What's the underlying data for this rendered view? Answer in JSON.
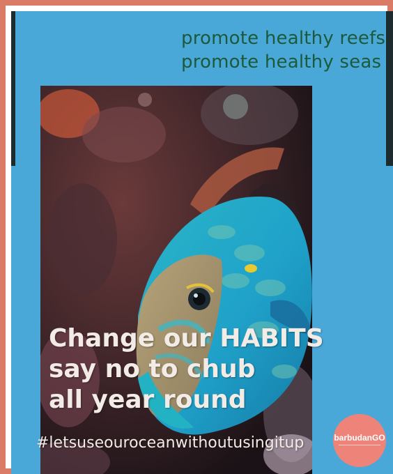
{
  "poster": {
    "headline_line1": "promote healthy reefs",
    "headline_line2": "promote healthy seas",
    "overlay_line1": "Change our HABITS",
    "overlay_line2": "say no to chub",
    "overlay_line3": "all year round",
    "hashtag": "#letsuseouroceanwithoutusingitup"
  },
  "logo": {
    "name": "barbudanGO"
  },
  "colors": {
    "frame": "#d97b66",
    "background": "#4aa8d8",
    "headline_text": "#1c5a3b",
    "overlay_text": "#f3ece6",
    "logo_circle": "#ee8479"
  }
}
